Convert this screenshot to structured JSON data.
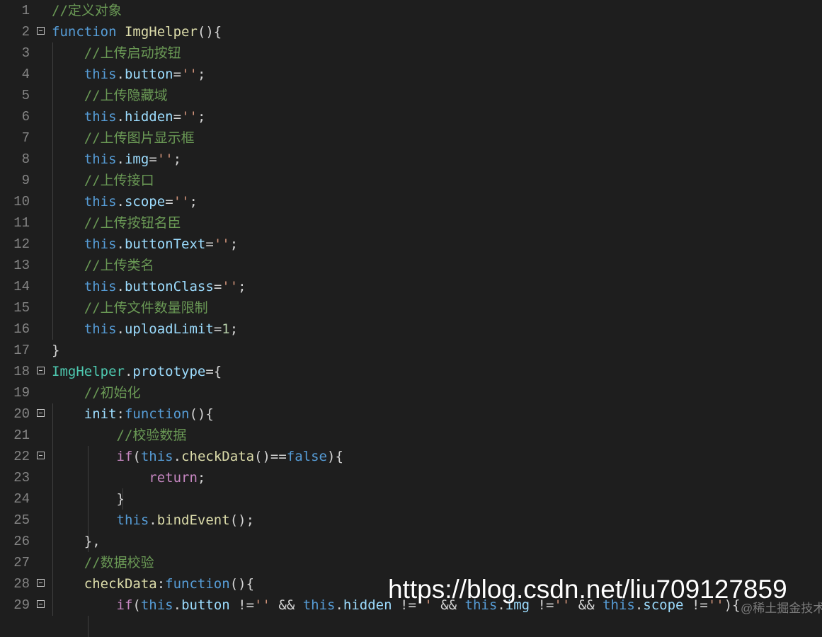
{
  "colors": {
    "background": "#1e1e1e",
    "line_number": "#858585",
    "comment": "#6a9955",
    "keyword": "#569cd6",
    "control": "#c586c0",
    "property": "#9cdcfe",
    "string": "#ce9178",
    "number": "#b5cea8",
    "class": "#4ec9b0",
    "function": "#dcdcaa",
    "punctuation": "#d4d4d4"
  },
  "lines": [
    {
      "n": "1",
      "fold": false,
      "tokens": [
        [
          "c",
          "//定义对象"
        ]
      ]
    },
    {
      "n": "2",
      "fold": true,
      "tokens": [
        [
          "k",
          "function"
        ],
        [
          "p",
          " "
        ],
        [
          "f",
          "ImgHelper"
        ],
        [
          "p",
          "(){"
        ]
      ]
    },
    {
      "n": "3",
      "fold": false,
      "tokens": [
        [
          "p",
          "    "
        ],
        [
          "c",
          "//上传启动按钮"
        ]
      ]
    },
    {
      "n": "4",
      "fold": false,
      "tokens": [
        [
          "p",
          "    "
        ],
        [
          "k",
          "this"
        ],
        [
          "p",
          "."
        ],
        [
          "v",
          "button"
        ],
        [
          "p",
          "="
        ],
        [
          "s",
          "''"
        ],
        [
          "p",
          ";"
        ]
      ]
    },
    {
      "n": "5",
      "fold": false,
      "tokens": [
        [
          "p",
          "    "
        ],
        [
          "c",
          "//上传隐藏域"
        ]
      ]
    },
    {
      "n": "6",
      "fold": false,
      "tokens": [
        [
          "p",
          "    "
        ],
        [
          "k",
          "this"
        ],
        [
          "p",
          "."
        ],
        [
          "v",
          "hidden"
        ],
        [
          "p",
          "="
        ],
        [
          "s",
          "''"
        ],
        [
          "p",
          ";"
        ]
      ]
    },
    {
      "n": "7",
      "fold": false,
      "tokens": [
        [
          "p",
          "    "
        ],
        [
          "c",
          "//上传图片显示框"
        ]
      ]
    },
    {
      "n": "8",
      "fold": false,
      "tokens": [
        [
          "p",
          "    "
        ],
        [
          "k",
          "this"
        ],
        [
          "p",
          "."
        ],
        [
          "v",
          "img"
        ],
        [
          "p",
          "="
        ],
        [
          "s",
          "''"
        ],
        [
          "p",
          ";"
        ]
      ]
    },
    {
      "n": "9",
      "fold": false,
      "tokens": [
        [
          "p",
          "    "
        ],
        [
          "c",
          "//上传接口"
        ]
      ]
    },
    {
      "n": "10",
      "fold": false,
      "tokens": [
        [
          "p",
          "    "
        ],
        [
          "k",
          "this"
        ],
        [
          "p",
          "."
        ],
        [
          "v",
          "scope"
        ],
        [
          "p",
          "="
        ],
        [
          "s",
          "''"
        ],
        [
          "p",
          ";"
        ]
      ]
    },
    {
      "n": "11",
      "fold": false,
      "tokens": [
        [
          "p",
          "    "
        ],
        [
          "c",
          "//上传按钮名臣"
        ]
      ]
    },
    {
      "n": "12",
      "fold": false,
      "tokens": [
        [
          "p",
          "    "
        ],
        [
          "k",
          "this"
        ],
        [
          "p",
          "."
        ],
        [
          "v",
          "buttonText"
        ],
        [
          "p",
          "="
        ],
        [
          "s",
          "''"
        ],
        [
          "p",
          ";"
        ]
      ]
    },
    {
      "n": "13",
      "fold": false,
      "tokens": [
        [
          "p",
          "    "
        ],
        [
          "c",
          "//上传类名"
        ]
      ]
    },
    {
      "n": "14",
      "fold": false,
      "tokens": [
        [
          "p",
          "    "
        ],
        [
          "k",
          "this"
        ],
        [
          "p",
          "."
        ],
        [
          "v",
          "buttonClass"
        ],
        [
          "p",
          "="
        ],
        [
          "s",
          "''"
        ],
        [
          "p",
          ";"
        ]
      ]
    },
    {
      "n": "15",
      "fold": false,
      "tokens": [
        [
          "p",
          "    "
        ],
        [
          "c",
          "//上传文件数量限制"
        ]
      ]
    },
    {
      "n": "16",
      "fold": false,
      "tokens": [
        [
          "p",
          "    "
        ],
        [
          "k",
          "this"
        ],
        [
          "p",
          "."
        ],
        [
          "v",
          "uploadLimit"
        ],
        [
          "p",
          "="
        ],
        [
          "n",
          "1"
        ],
        [
          "p",
          ";"
        ]
      ]
    },
    {
      "n": "17",
      "fold": false,
      "tokens": [
        [
          "p",
          "}"
        ]
      ]
    },
    {
      "n": "18",
      "fold": true,
      "tokens": [
        [
          "t",
          "ImgHelper"
        ],
        [
          "p",
          "."
        ],
        [
          "v",
          "prototype"
        ],
        [
          "p",
          "={"
        ]
      ]
    },
    {
      "n": "19",
      "fold": false,
      "tokens": [
        [
          "p",
          "    "
        ],
        [
          "c",
          "//初始化"
        ]
      ]
    },
    {
      "n": "20",
      "fold": true,
      "tokens": [
        [
          "p",
          "    "
        ],
        [
          "v",
          "init"
        ],
        [
          "p",
          ":"
        ],
        [
          "k",
          "function"
        ],
        [
          "p",
          "(){"
        ]
      ]
    },
    {
      "n": "21",
      "fold": false,
      "tokens": [
        [
          "p",
          "        "
        ],
        [
          "c",
          "//校验数据"
        ]
      ]
    },
    {
      "n": "22",
      "fold": true,
      "tokens": [
        [
          "p",
          "        "
        ],
        [
          "x",
          "if"
        ],
        [
          "p",
          "("
        ],
        [
          "k",
          "this"
        ],
        [
          "p",
          "."
        ],
        [
          "f",
          "checkData"
        ],
        [
          "p",
          "()=="
        ],
        [
          "k",
          "false"
        ],
        [
          "p",
          "){"
        ]
      ]
    },
    {
      "n": "23",
      "fold": false,
      "tokens": [
        [
          "p",
          "            "
        ],
        [
          "x",
          "return"
        ],
        [
          "p",
          ";"
        ]
      ]
    },
    {
      "n": "24",
      "fold": false,
      "tokens": [
        [
          "p",
          "        }"
        ]
      ]
    },
    {
      "n": "25",
      "fold": false,
      "tokens": [
        [
          "p",
          "        "
        ],
        [
          "k",
          "this"
        ],
        [
          "p",
          "."
        ],
        [
          "f",
          "bindEvent"
        ],
        [
          "p",
          "();"
        ]
      ]
    },
    {
      "n": "26",
      "fold": false,
      "tokens": [
        [
          "p",
          "    },"
        ]
      ]
    },
    {
      "n": "27",
      "fold": false,
      "tokens": [
        [
          "p",
          "    "
        ],
        [
          "c",
          "//数据校验"
        ]
      ]
    },
    {
      "n": "28",
      "fold": true,
      "tokens": [
        [
          "p",
          "    "
        ],
        [
          "f",
          "checkData"
        ],
        [
          "p",
          ":"
        ],
        [
          "k",
          "function"
        ],
        [
          "p",
          "(){"
        ]
      ]
    },
    {
      "n": "29",
      "fold": true,
      "tokens": [
        [
          "p",
          "        "
        ],
        [
          "x",
          "if"
        ],
        [
          "p",
          "("
        ],
        [
          "k",
          "this"
        ],
        [
          "p",
          "."
        ],
        [
          "v",
          "button"
        ],
        [
          "p",
          " !="
        ],
        [
          "s",
          "''"
        ],
        [
          "p",
          " && "
        ],
        [
          "k",
          "this"
        ],
        [
          "p",
          "."
        ],
        [
          "v",
          "hidden"
        ],
        [
          "p",
          " !="
        ],
        [
          "s",
          "''"
        ],
        [
          "p",
          " && "
        ],
        [
          "k",
          "this"
        ],
        [
          "p",
          "."
        ],
        [
          "v",
          "img"
        ],
        [
          "p",
          " !="
        ],
        [
          "s",
          "''"
        ],
        [
          "p",
          " && "
        ],
        [
          "k",
          "this"
        ],
        [
          "p",
          "."
        ],
        [
          "v",
          "scope"
        ],
        [
          "p",
          " !="
        ],
        [
          "s",
          "''"
        ],
        [
          "p",
          "){"
        ]
      ]
    }
  ],
  "watermark": "https://blog.csdn.net/liu709127859",
  "watermark_sub": "@稀土掘金技术社区"
}
